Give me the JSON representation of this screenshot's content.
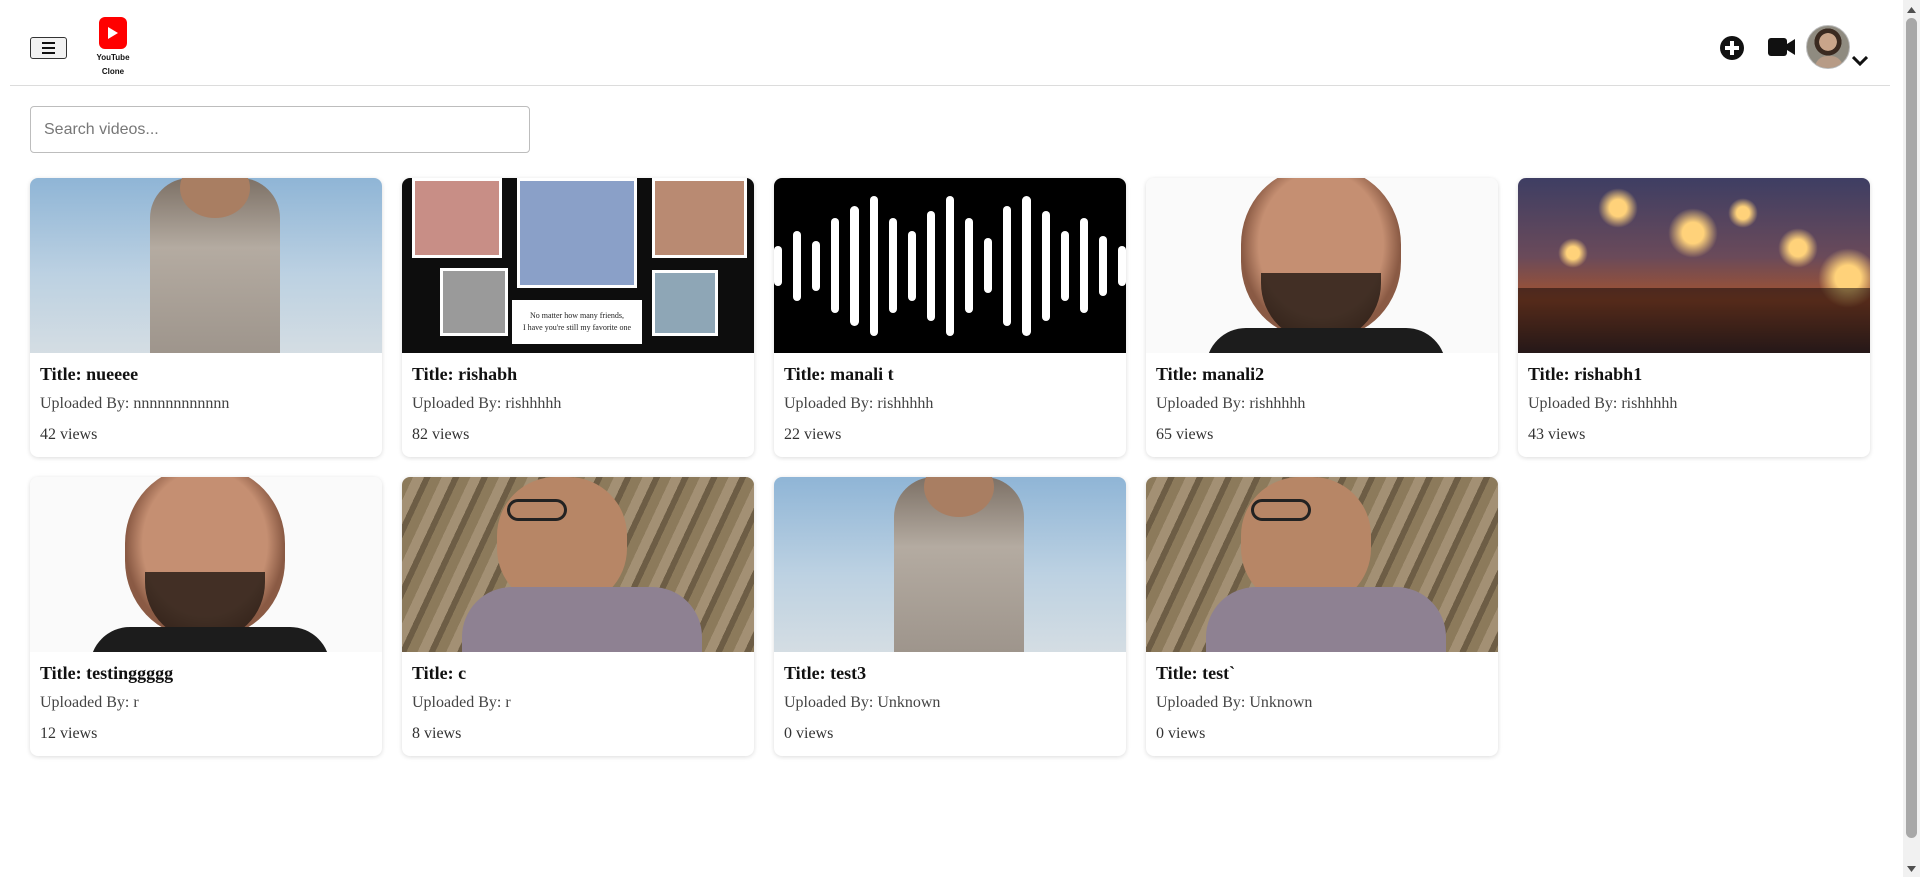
{
  "header": {
    "logo_text_line1": "YouTube",
    "logo_text_line2": "Clone",
    "brand_color": "#ff0000",
    "icons": [
      "menu-icon",
      "add-circle-icon",
      "video-camera-icon",
      "chevron-down-icon"
    ]
  },
  "search": {
    "placeholder": "Search videos...",
    "value": ""
  },
  "videos": [
    {
      "title": "Title: nueeee",
      "uploader": "Uploaded By: nnnnnnnnnnnn",
      "views": "42 views",
      "thumb": "sky"
    },
    {
      "title": "Title: rishabh",
      "uploader": "Uploaded By: rishhhhh",
      "views": "82 views",
      "thumb": "collage",
      "thumb_caption_1": "No matter how many friends,",
      "thumb_caption_2": "I have you're still my favorite one"
    },
    {
      "title": "Title: manali t",
      "uploader": "Uploaded By: rishhhhh",
      "views": "22 views",
      "thumb": "audio"
    },
    {
      "title": "Title: manali2",
      "uploader": "Uploaded By: rishhhhh",
      "views": "65 views",
      "thumb": "face"
    },
    {
      "title": "Title: rishabh1",
      "uploader": "Uploaded By: rishhhhh",
      "views": "43 views",
      "thumb": "ghat"
    },
    {
      "title": "Title: testinggggg",
      "uploader": "Uploaded By: r",
      "views": "12 views",
      "thumb": "face"
    },
    {
      "title": "Title: c",
      "uploader": "Uploaded By: r",
      "views": "8 views",
      "thumb": "wood"
    },
    {
      "title": "Title: test3",
      "uploader": "Uploaded By: Unknown",
      "views": "0 views",
      "thumb": "sky"
    },
    {
      "title": "Title: test`",
      "uploader": "Uploaded By: Unknown",
      "views": "0 views",
      "thumb": "wood"
    }
  ]
}
